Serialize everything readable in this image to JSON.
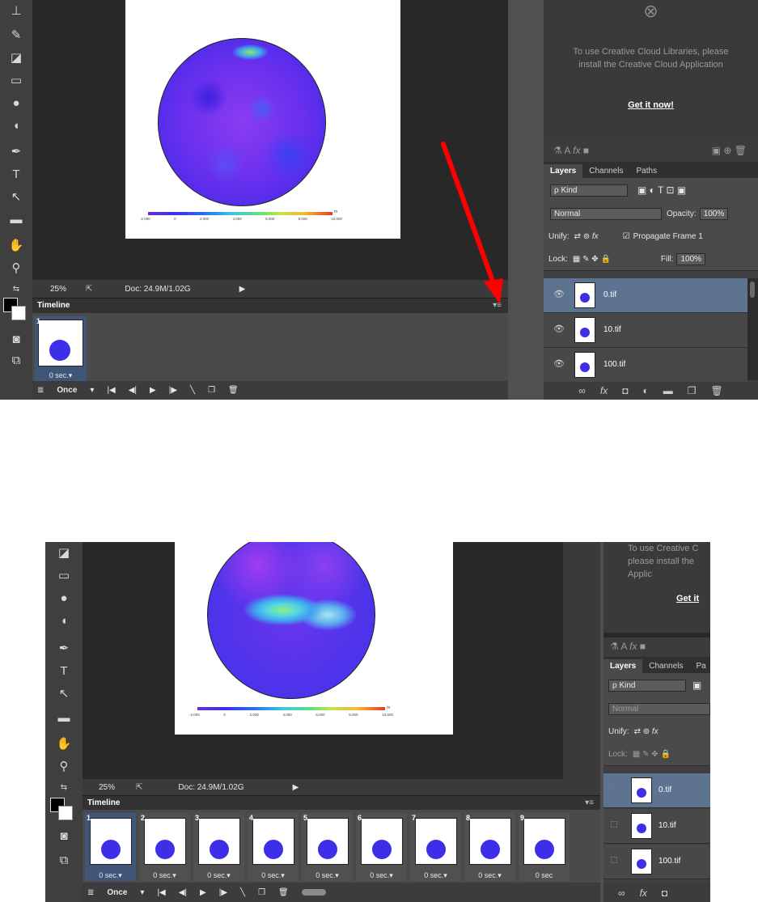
{
  "colorbar_ticks": [
    "-2,000",
    "0",
    "2,000",
    "4,000",
    "6,000",
    "8,000",
    "10,000"
  ],
  "colorbar_unit": "m",
  "status": {
    "zoom": "25%",
    "doc": "Doc: 24.9M/1.02G"
  },
  "timeline": {
    "title": "Timeline",
    "loop": "Once",
    "frames_top": [
      {
        "num": "1",
        "dur": "0 sec.▾"
      }
    ],
    "frames_bottom": [
      {
        "num": "1",
        "dur": "0 sec.▾"
      },
      {
        "num": "2",
        "dur": "0 sec.▾"
      },
      {
        "num": "3",
        "dur": "0 sec.▾"
      },
      {
        "num": "4",
        "dur": "0 sec.▾"
      },
      {
        "num": "5",
        "dur": "0 sec.▾"
      },
      {
        "num": "6",
        "dur": "0 sec.▾"
      },
      {
        "num": "7",
        "dur": "0 sec.▾"
      },
      {
        "num": "8",
        "dur": "0 sec.▾"
      },
      {
        "num": "9",
        "dur": "0 sec"
      }
    ]
  },
  "libraries": {
    "message": "To use Creative Cloud Libraries, please install the Creative Cloud Application",
    "cta": "Get it now!",
    "message_cropped": "To use Creative C please install the Applic",
    "cta_cropped": "Get it"
  },
  "layers_panel": {
    "tabs": [
      "Layers",
      "Channels",
      "Paths"
    ],
    "tabs_cropped": [
      "Layers",
      "Channels",
      "Pa"
    ],
    "filter": "ρ Kind",
    "blend_mode": "Normal",
    "opacity_label": "Opacity:",
    "opacity_value": "100%",
    "unify_label": "Unify:",
    "propagate_label": "Propagate Frame 1",
    "lock_label": "Lock:",
    "fill_label": "Fill:",
    "fill_value": "100%",
    "layers": [
      {
        "name": "0.tif"
      },
      {
        "name": "10.tif"
      },
      {
        "name": "100.tif"
      }
    ]
  },
  "annotation": {
    "arrow_color": "#ff0000"
  },
  "colors": {
    "selected_layer": "#5d7390",
    "selected_frame": "#3f5678",
    "panel_bg": "#3f3f3f"
  }
}
